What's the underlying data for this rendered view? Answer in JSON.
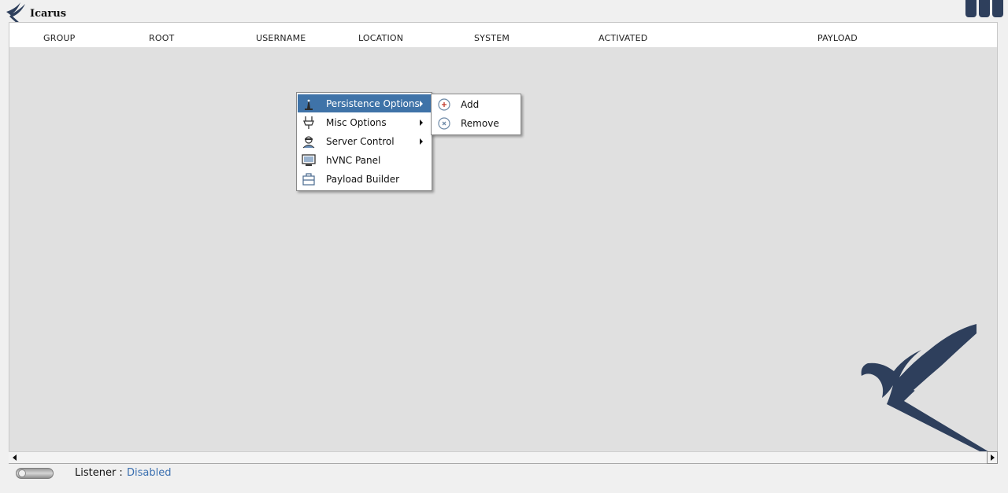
{
  "app": {
    "title": "Icarus"
  },
  "table": {
    "columns": [
      "GROUP",
      "ROOT",
      "USERNAME",
      "LOCATION",
      "SYSTEM",
      "ACTIVATED",
      "PAYLOAD"
    ],
    "rows": []
  },
  "context_menu": {
    "items": [
      {
        "label": "Persistence Options",
        "icon": "tower-icon",
        "has_submenu": true,
        "selected": true
      },
      {
        "label": "Misc Options",
        "icon": "plug-icon",
        "has_submenu": true,
        "selected": false
      },
      {
        "label": "Server Control",
        "icon": "user-server-icon",
        "has_submenu": true,
        "selected": false
      },
      {
        "label": "hVNC Panel",
        "icon": "monitor-icon",
        "has_submenu": false,
        "selected": false
      },
      {
        "label": "Payload Builder",
        "icon": "builder-icon",
        "has_submenu": false,
        "selected": false
      }
    ],
    "submenu": {
      "items": [
        {
          "label": "Add",
          "icon": "add-circle-icon"
        },
        {
          "label": "Remove",
          "icon": "remove-circle-icon"
        }
      ]
    }
  },
  "status": {
    "listener_label": "Listener :",
    "listener_value": "Disabled",
    "toggle_on": false
  },
  "colors": {
    "accent": "#3f73a8",
    "status_value": "#3a6fb0",
    "brand": "#2e3f5c"
  }
}
